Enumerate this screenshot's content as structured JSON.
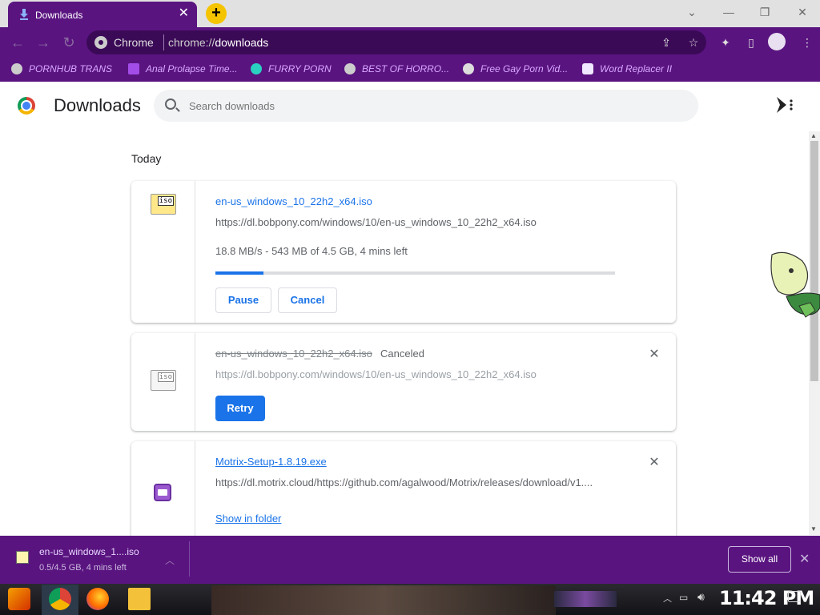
{
  "tab": {
    "title": "Downloads",
    "close": "✕",
    "new_tab": "+"
  },
  "window_controls": {
    "minimize": "—",
    "restore": "❐",
    "close": "✕",
    "dropdown": "⌄"
  },
  "omnibox": {
    "brand": "Chrome",
    "url_prefix": "chrome://",
    "url_host": "downloads"
  },
  "bookmarks": [
    {
      "label": "PORNHUB TRANS"
    },
    {
      "label": "Anal Prolapse Time..."
    },
    {
      "label": "FURRY PORN"
    },
    {
      "label": "BEST OF HORRO..."
    },
    {
      "label": "Free Gay Porn Vid..."
    },
    {
      "label": "Word Replacer II"
    }
  ],
  "page": {
    "title": "Downloads",
    "search_placeholder": "Search downloads",
    "section": "Today"
  },
  "downloads": [
    {
      "filename": "en-us_windows_10_22h2_x64.iso",
      "url": "https://dl.bobpony.com/windows/10/en-us_windows_10_22h2_x64.iso",
      "status": "18.8 MB/s - 543 MB of 4.5 GB, 4 mins left",
      "progress": 0.12,
      "pause_label": "Pause",
      "cancel_label": "Cancel",
      "icon_text": "iso"
    },
    {
      "filename": "en-us_windows_10_22h2_x64.iso",
      "url": "https://dl.bobpony.com/windows/10/en-us_windows_10_22h2_x64.iso",
      "state": "Canceled",
      "retry_label": "Retry",
      "icon_text": "iso"
    },
    {
      "filename": "Motrix-Setup-1.8.19.exe",
      "url": "https://dl.motrix.cloud/https://github.com/agalwood/Motrix/releases/download/v1....",
      "show_in_folder": "Show in folder"
    }
  ],
  "download_bar": {
    "name": "en-us_windows_1....iso",
    "status": "0.5/4.5 GB, 4 mins left",
    "show_all": "Show all",
    "close": "✕"
  },
  "taskbar": {
    "clock": "11:42 PM"
  },
  "colors": {
    "chrome_purple": "#5a1480",
    "accent_blue": "#1a73e8",
    "progress_track": "#dadce0"
  }
}
